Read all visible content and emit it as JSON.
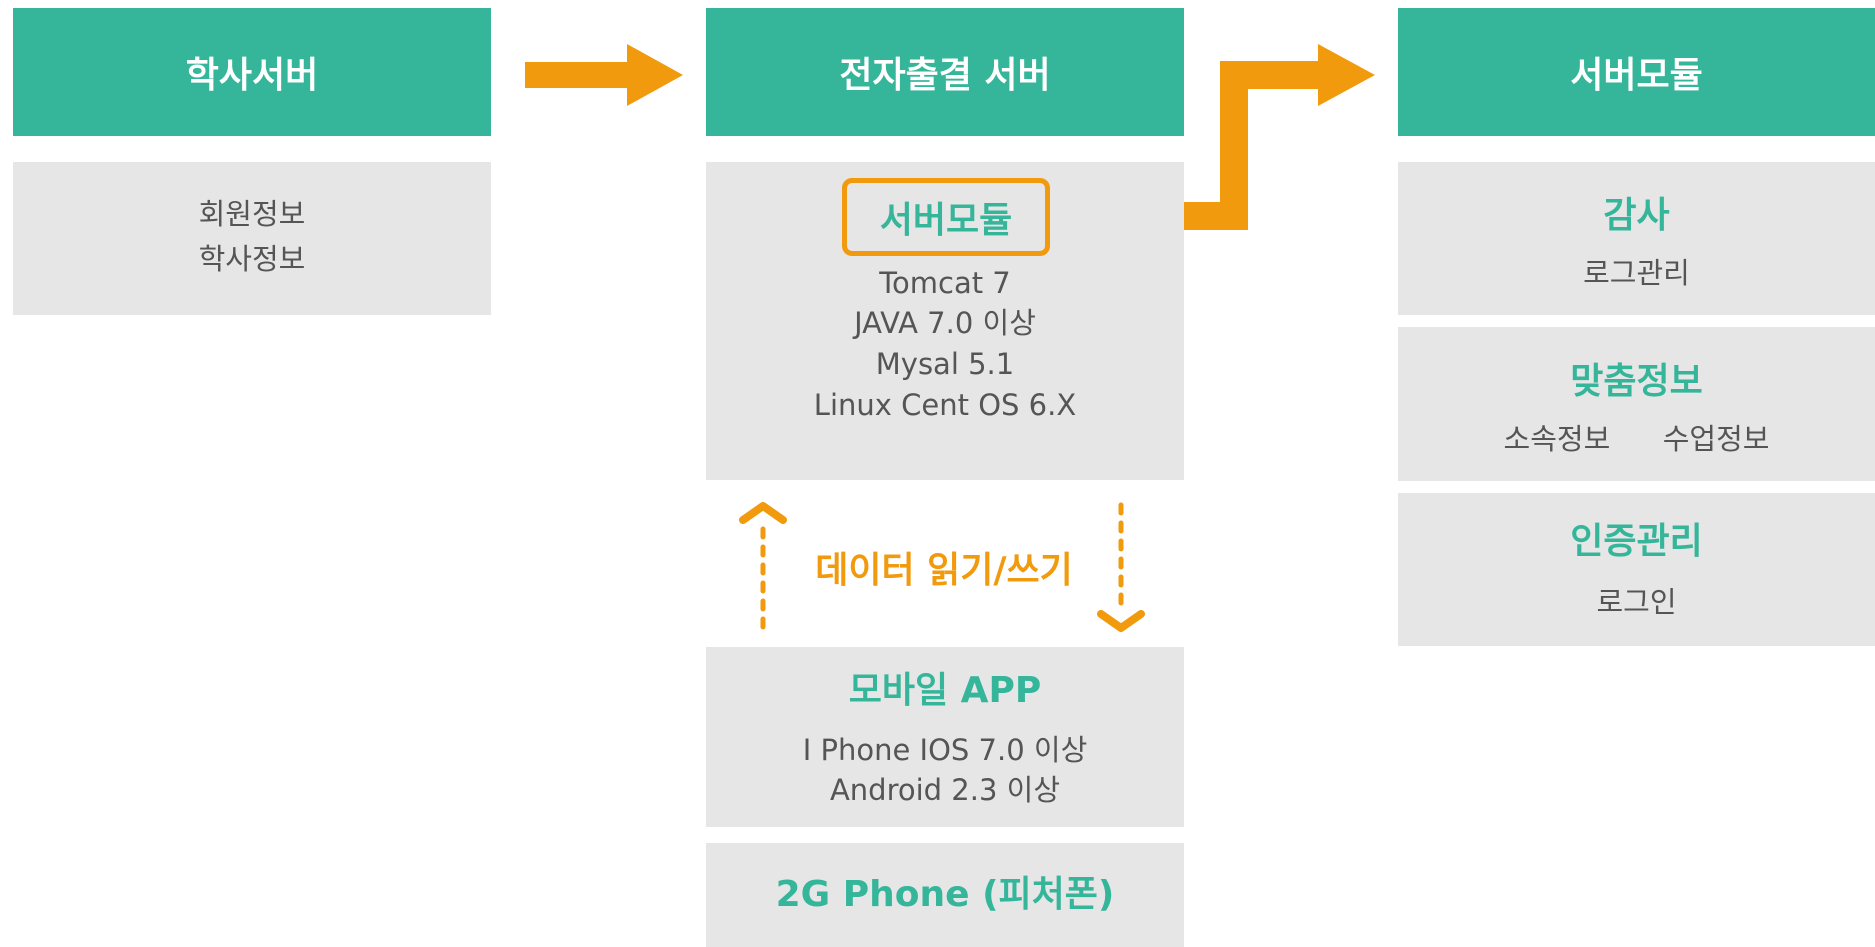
{
  "academic": {
    "header": "학사서버",
    "items": [
      "회원정보",
      "학사정보"
    ]
  },
  "attendance": {
    "header": "전자출결 서버",
    "module_label": "서버모듈",
    "specs": [
      "Tomcat 7",
      "JAVA 7.0 이상",
      "Mysal 5.1",
      "Linux Cent OS 6.X"
    ],
    "data_rw": "데이터 읽기/쓰기",
    "mobile": {
      "title": "모바일 APP",
      "lines": [
        "I Phone IOS 7.0 이상",
        "Android 2.3 이상"
      ]
    },
    "feature_phone": "2G Phone (피처폰)"
  },
  "server_module": {
    "header": "서버모듈",
    "audit": {
      "title": "감사",
      "sub": "로그관리"
    },
    "custom": {
      "title": "맞춤정보",
      "sub1": "소속정보",
      "sub2": "수업정보"
    },
    "auth": {
      "title": "인증관리",
      "sub": "로그인"
    }
  },
  "colors": {
    "green": "#35b59a",
    "orange": "#f19a0e",
    "panel_gray": "#e6e6e6",
    "text_gray": "#555555"
  }
}
